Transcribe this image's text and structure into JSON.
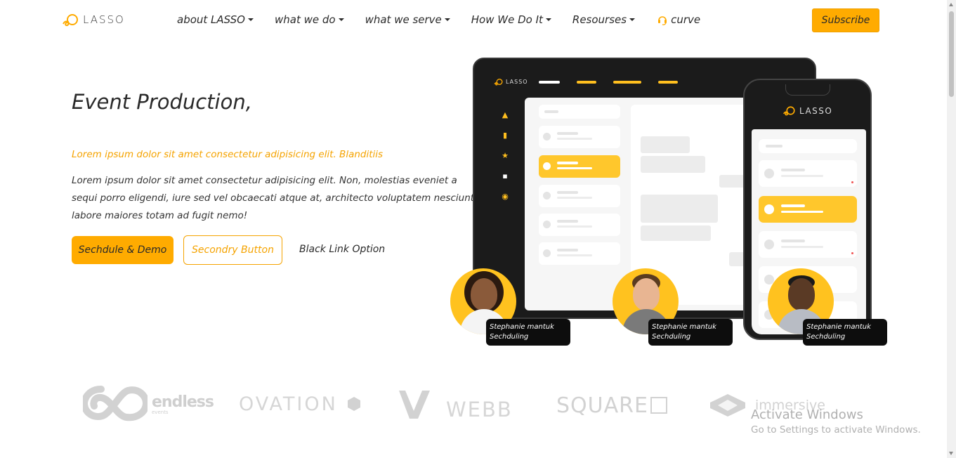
{
  "nav": {
    "logo_text": "LASSO",
    "items": [
      {
        "label": "about LASSO",
        "has_caret": true
      },
      {
        "label": "what we do",
        "has_caret": true
      },
      {
        "label": "what we serve",
        "has_caret": true
      },
      {
        "label": "How We Do It",
        "has_caret": true
      },
      {
        "label": "Resourses",
        "has_caret": true
      },
      {
        "label": "curve",
        "has_caret": false,
        "icon": "headset-icon"
      }
    ],
    "subscribe_label": "Subscribe"
  },
  "hero": {
    "title": "Event Production,",
    "subtitle": "Lorem ipsum dolor sit amet consectetur adipisicing elit. Blanditiis",
    "body": "Lorem ipsum dolor sit amet consectetur adipisicing elit. Non, molestias eveniet a sequi porro eligendi, iure sed vel obcaecati atque at, architecto voluptatem nesciunt labore maiores totam ad fugit nemo!",
    "primary_button": "Sechdule & Demo",
    "secondary_button": "Secondry Button",
    "link_button": "Black Link Option"
  },
  "devices": {
    "tablet_logo": "LASSO",
    "phone_logo": "LASSO"
  },
  "avatars": [
    {
      "name": "Stephanie mantuk",
      "role": "Sechduling"
    },
    {
      "name": "Stephanie mantuk",
      "role": "Sechduling"
    },
    {
      "name": "Stephanie mantuk",
      "role": "Sechduling"
    }
  ],
  "brands": {
    "endless": "endless",
    "endless_sub": "events",
    "ovation": "OVATION",
    "webb": "WEBB",
    "square": "SQUARE",
    "immersive": "immersive"
  },
  "os_overlay": {
    "title": "Activate Windows",
    "subtitle": "Go to Settings to activate Windows."
  },
  "colors": {
    "accent": "#ffab00",
    "accent_text": "#f5a300",
    "dark": "#1b1b1b"
  }
}
